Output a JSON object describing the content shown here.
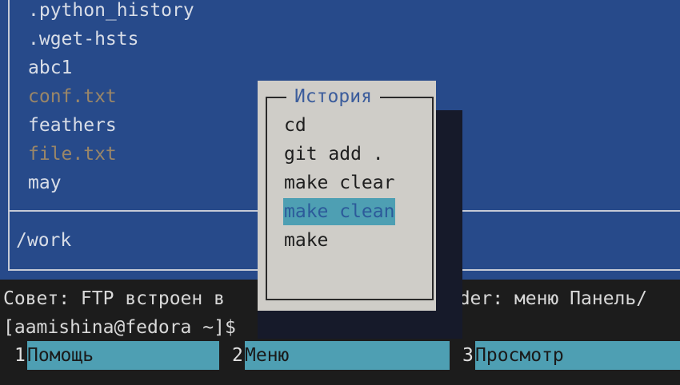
{
  "panel": {
    "files": [
      {
        "name": ".python_history",
        "kind": "file"
      },
      {
        "name": ".wget-hsts",
        "kind": "file"
      },
      {
        "name": "abc1",
        "kind": "file"
      },
      {
        "name": "conf.txt",
        "kind": "archive"
      },
      {
        "name": "feathers",
        "kind": "file"
      },
      {
        "name": "file.txt",
        "kind": "archive"
      },
      {
        "name": "may",
        "kind": "file"
      }
    ],
    "current_dir": "/work"
  },
  "history_dialog": {
    "title": "История",
    "items": [
      "cd",
      "git add .",
      "make clear",
      "make clean",
      "make"
    ],
    "selected_index": 3
  },
  "hint": {
    "visible_start": "Совет: FTP встроен в",
    "visible_end": "ander: меню Панель/"
  },
  "prompt": "[aamishina@fedora ~]$",
  "function_keys": [
    {
      "num": "1",
      "label": "Помощь"
    },
    {
      "num": "2",
      "label": "Меню"
    },
    {
      "num": "3",
      "label": "Просмотр"
    }
  ],
  "colors": {
    "panel_bg": "#274a8a",
    "dialog_bg": "#cfcdc8",
    "selection": "#4e9fb3",
    "archive_file": "#9a8668",
    "terminal_bg": "#1c1c1c"
  }
}
